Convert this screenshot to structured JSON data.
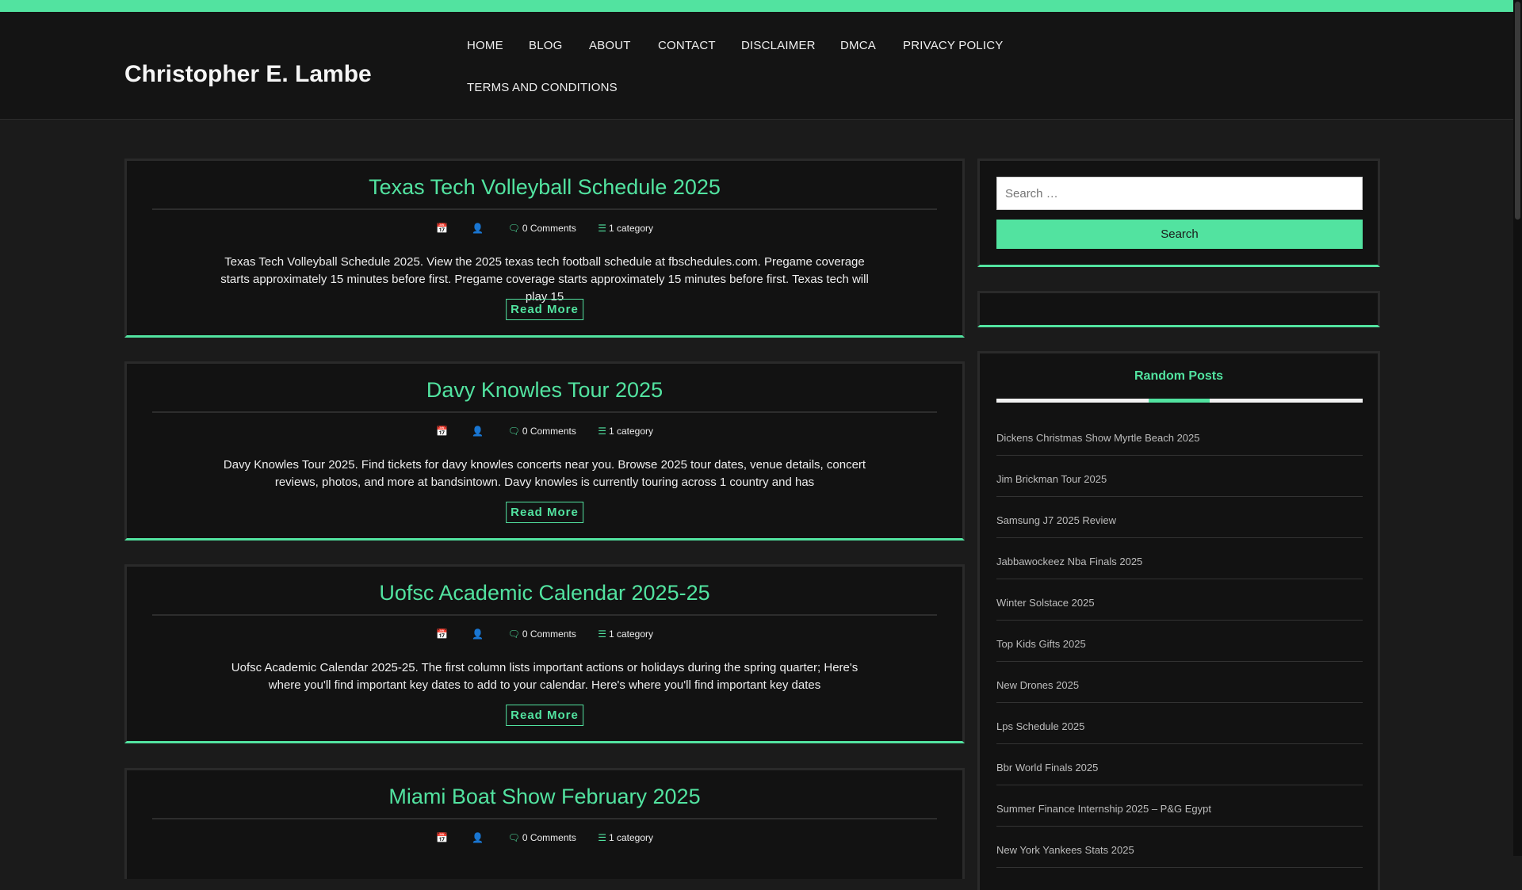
{
  "site": {
    "title": "Christopher E. Lambe"
  },
  "nav": {
    "items": [
      {
        "label": "HOME"
      },
      {
        "label": "BLOG"
      },
      {
        "label": "ABOUT"
      },
      {
        "label": "CONTACT"
      },
      {
        "label": "DISCLAIMER"
      },
      {
        "label": "DMCA"
      },
      {
        "label": "PRIVACY POLICY"
      },
      {
        "label": "TERMS AND CONDITIONS"
      }
    ]
  },
  "posts": [
    {
      "title": "Texas Tech Volleyball Schedule 2025",
      "comments": "0 Comments",
      "category": "1 category",
      "excerpt": "Texas Tech Volleyball Schedule 2025. View the 2025 texas tech football schedule at fbschedules.com. Pregame coverage starts approximately 15 minutes before first. Pregame coverage starts approximately 15 minutes before first. Texas tech will play 15",
      "read_more": "Read More"
    },
    {
      "title": "Davy Knowles Tour 2025",
      "comments": "0 Comments",
      "category": "1 category",
      "excerpt": "Davy Knowles Tour 2025. Find tickets for davy knowles concerts near you. Browse 2025 tour dates, venue details, concert reviews, photos, and more at bandsintown. Davy knowles is currently touring across 1 country and has",
      "read_more": "Read More"
    },
    {
      "title": "Uofsc Academic Calendar 2025-25",
      "comments": "0 Comments",
      "category": "1 category",
      "excerpt": "Uofsc Academic Calendar 2025-25. The first column lists important actions or holidays during the spring quarter; Here's where you'll find important key dates to add to your calendar. Here's where you'll find important key dates",
      "read_more": "Read More"
    },
    {
      "title": "Miami Boat Show February 2025",
      "comments": "0 Comments",
      "category": "1 category"
    }
  ],
  "search": {
    "placeholder": "Search …",
    "button_label": "Search"
  },
  "random_posts": {
    "title": "Random Posts",
    "items": [
      "Dickens Christmas Show Myrtle Beach 2025",
      "Jim Brickman Tour 2025",
      "Samsung J7 2025 Review",
      "Jabbawockeez Nba Finals 2025",
      "Winter Solstace 2025",
      "Top Kids Gifts 2025",
      "New Drones 2025",
      "Lps Schedule 2025",
      "Bbr World Finals 2025",
      "Summer Finance Internship 2025 – P&G Egypt",
      "New York Yankees Stats 2025"
    ]
  },
  "icons": {
    "date": "calendar-icon",
    "author": "user-icon",
    "comments": "comments-icon",
    "category": "list-icon"
  },
  "colors": {
    "accent": "#52e3a0",
    "background": "#1b1b1b",
    "panel": "#121212"
  }
}
